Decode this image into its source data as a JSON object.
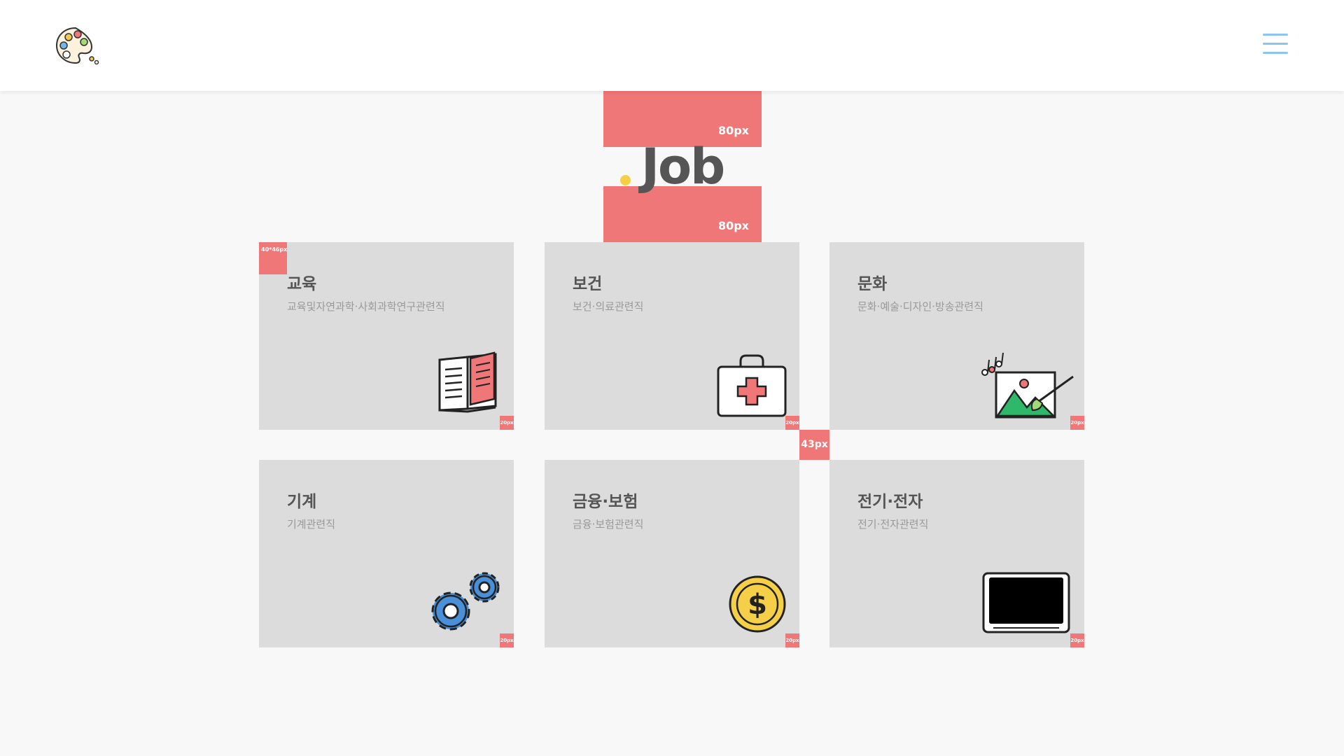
{
  "header": {
    "logo_icon": "palette-icon",
    "menu_icon": "hamburger-menu-icon"
  },
  "guides": {
    "top_label": "80px",
    "bottom_label": "80px",
    "icon_box_label": "40*46px",
    "gap_label": "43px",
    "corner_label": "20px"
  },
  "page": {
    "title": "Job",
    "accent_color": "#f5cf48",
    "guide_color": "#ef7777"
  },
  "cards": [
    {
      "title": "교육",
      "subtitle": "교육및자연과학·사회과학연구관련직",
      "icon": "open-book-icon"
    },
    {
      "title": "보건",
      "subtitle": "보건·의료관련직",
      "icon": "first-aid-kit-icon"
    },
    {
      "title": "문화",
      "subtitle": "문화·예술·디자인·방송관련직",
      "icon": "painting-canvas-icon"
    },
    {
      "title": "기계",
      "subtitle": "기계관련직",
      "icon": "gears-icon"
    },
    {
      "title": "금융·보험",
      "subtitle": "금융·보험관련직",
      "icon": "dollar-coin-icon"
    },
    {
      "title": "전기·전자",
      "subtitle": "전기·전자관련직",
      "icon": "tablet-screen-icon"
    }
  ]
}
